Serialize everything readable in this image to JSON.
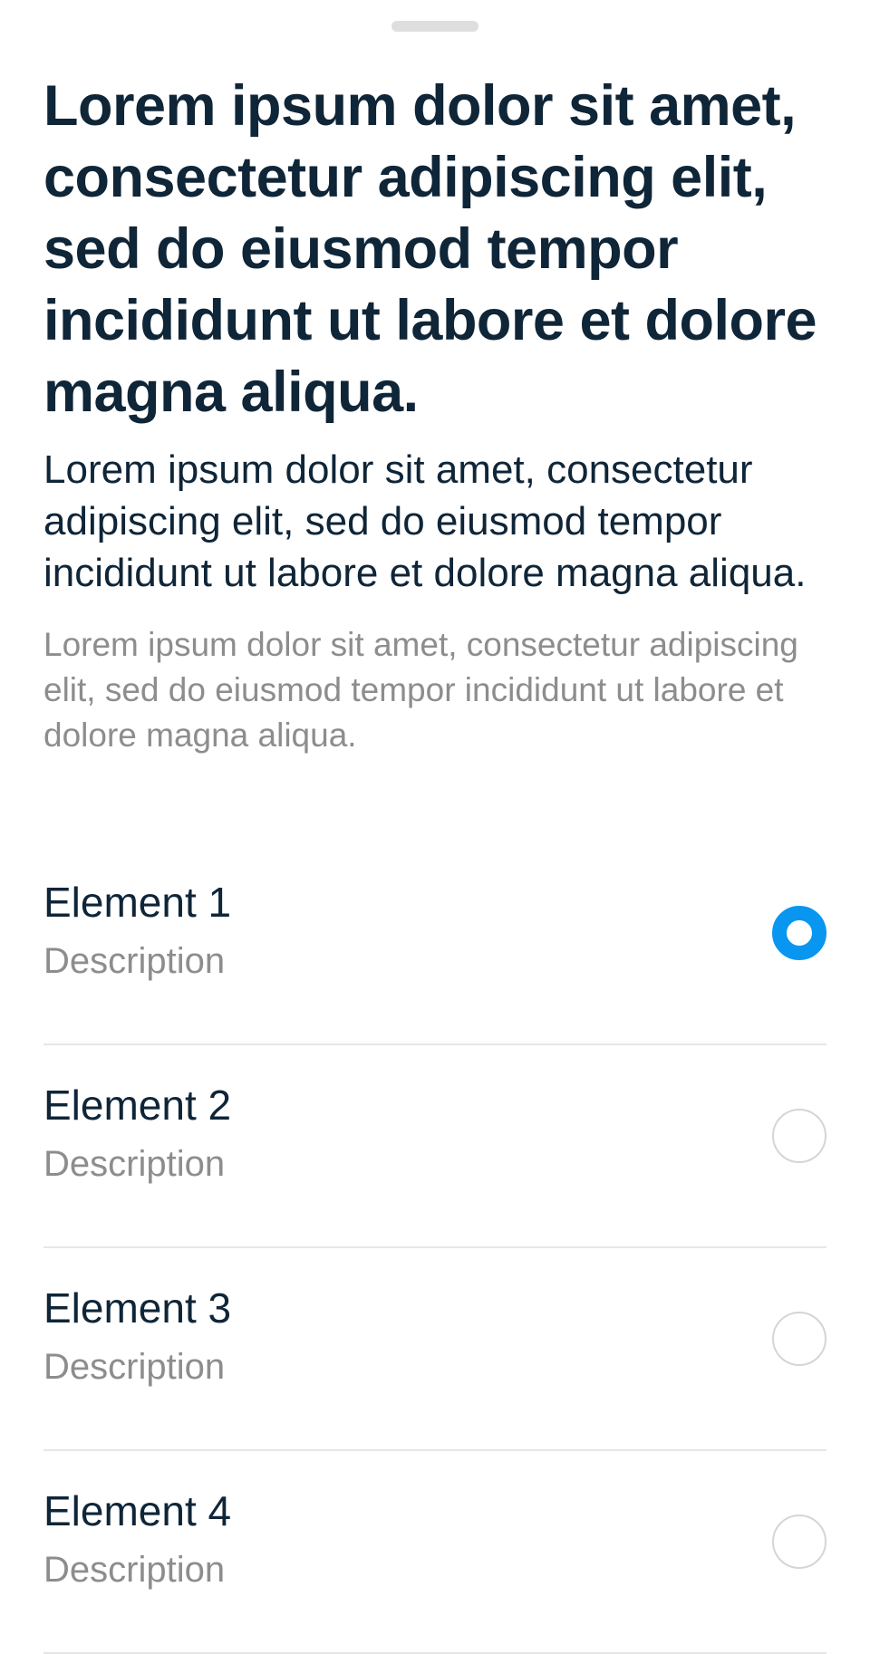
{
  "sheet": {
    "title": "Lorem ipsum dolor sit amet, consectetur adipiscing elit, sed do eiusmod tempor incididunt ut labore et dolore magna aliqua.",
    "subtitle": "Lorem ipsum dolor sit amet, consectetur adipiscing elit, sed do eiusmod tempor incididunt ut labore et dolore magna aliqua.",
    "caption": "Lorem ipsum dolor sit amet, consectetur adipiscing elit, sed do eiusmod tempor incididunt ut labore et dolore magna aliqua."
  },
  "options": [
    {
      "label": "Element 1",
      "description": "Description",
      "selected": true
    },
    {
      "label": "Element 2",
      "description": "Description",
      "selected": false
    },
    {
      "label": "Element 3",
      "description": "Description",
      "selected": false
    },
    {
      "label": "Element 4",
      "description": "Description",
      "selected": false
    }
  ],
  "colors": {
    "accent": "#0996f0",
    "text_primary": "#0f2538",
    "text_secondary": "#8d8d8d",
    "divider": "#e6e6e6",
    "radio_border": "#d5d5d5",
    "grabber": "#dedede"
  }
}
